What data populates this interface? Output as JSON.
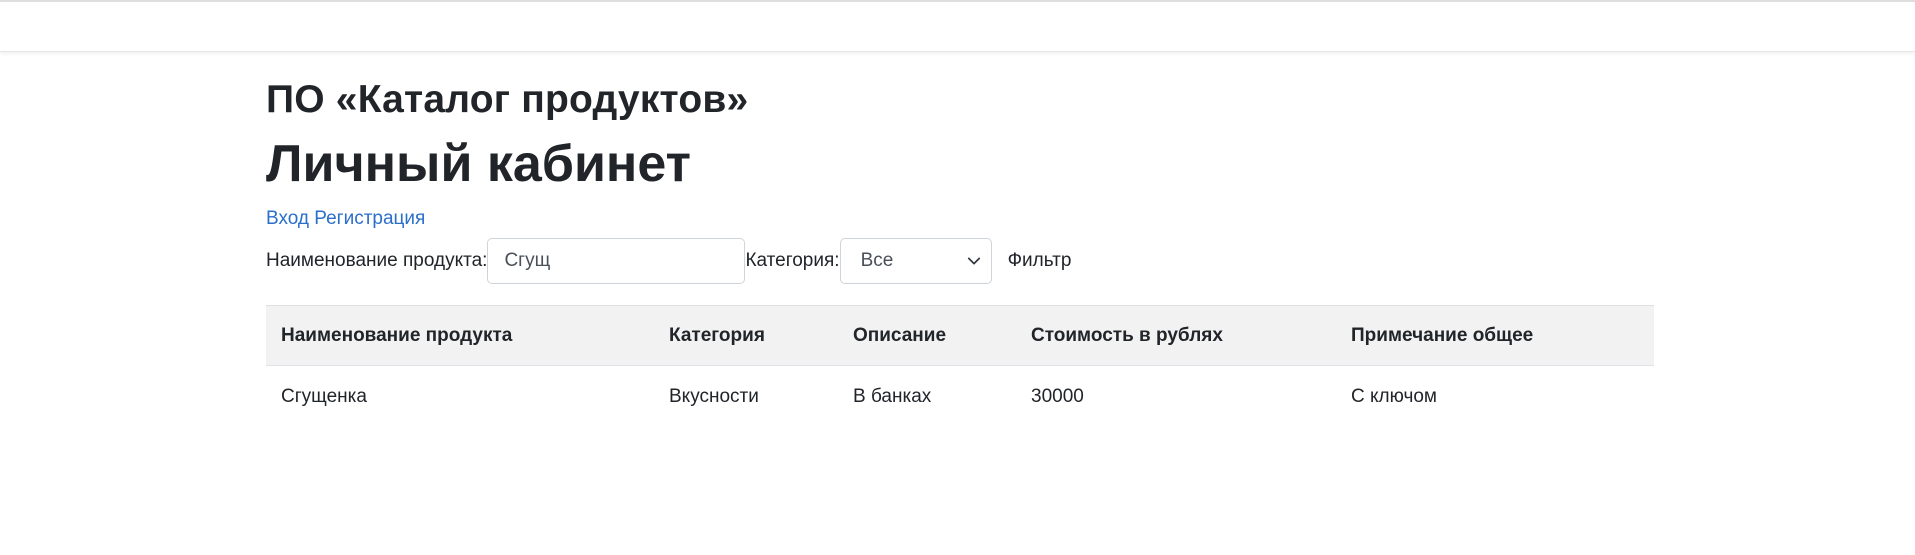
{
  "header": {
    "app_title": "ПО «Каталог продуктов»",
    "page_title": "Личный кабинет"
  },
  "auth": {
    "login_label": "Вход",
    "register_label": "Регистрация"
  },
  "filters": {
    "product_name_label": "Наименование продукта:",
    "product_name_value": "Сгущ",
    "category_label": "Категория:",
    "category_selected": "Все",
    "filter_button_label": "Фильтр"
  },
  "table": {
    "columns": [
      "Наименование продукта",
      "Категория",
      "Описание",
      "Стоимость в рублях",
      "Примечание общее"
    ],
    "rows": [
      [
        "Сгущенка",
        "Вкусности",
        "В банках",
        "30000",
        "С ключом"
      ]
    ]
  }
}
